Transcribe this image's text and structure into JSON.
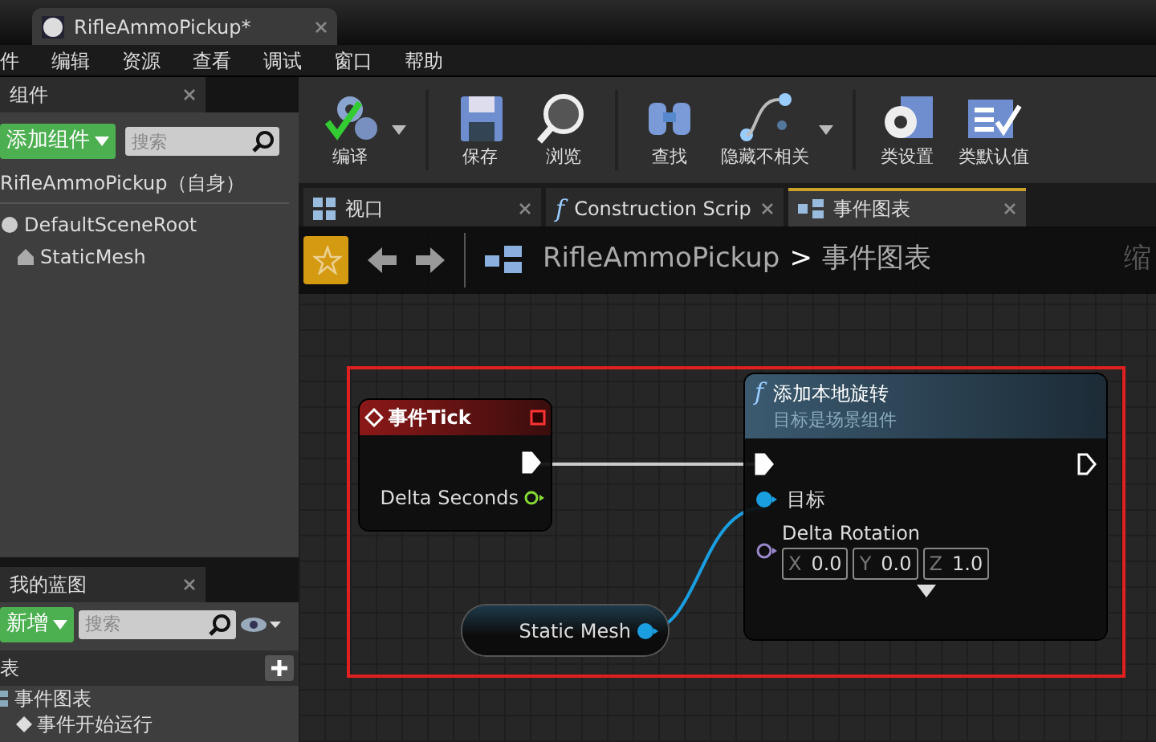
{
  "window": {
    "tab_title": "RifleAmmoPickup*"
  },
  "menu": [
    "件",
    "编辑",
    "资源",
    "查看",
    "调试",
    "窗口",
    "帮助"
  ],
  "components_panel": {
    "tab": "组件",
    "add_button": "添加组件",
    "search": {
      "placeholder": "搜索"
    },
    "self_label": "RifleAmmoPickup（自身）",
    "tree": [
      {
        "label": "DefaultSceneRoot",
        "children": [
          {
            "label": "StaticMesh"
          }
        ]
      }
    ]
  },
  "my_blueprint_panel": {
    "tab": "我的蓝图",
    "new_button": "新增",
    "search": {
      "placeholder": "搜索"
    },
    "section": "表",
    "items": [
      {
        "label": "事件图表",
        "children": [
          {
            "label": "事件开始运行"
          }
        ]
      }
    ]
  },
  "toolbar": [
    {
      "label": "编译",
      "dropdown": true
    },
    {
      "label": "保存",
      "dropdown": false
    },
    {
      "label": "浏览",
      "dropdown": false
    },
    {
      "label": "查找",
      "dropdown": false
    },
    {
      "label": "隐藏不相关",
      "dropdown": true
    },
    {
      "label": "类设置",
      "dropdown": false
    },
    {
      "label": "类默认值",
      "dropdown": false
    }
  ],
  "editor_tabs": [
    {
      "label": "视口",
      "selected": false
    },
    {
      "label": "Construction Scrip",
      "selected": false,
      "glyph": "f"
    },
    {
      "label": "事件图表",
      "selected": true
    }
  ],
  "breadcrumb": {
    "path": [
      "RifleAmmoPickup",
      "事件图表"
    ],
    "separator": ">",
    "zoom_label": "缩"
  },
  "graph": {
    "nodes": [
      {
        "kind": "event",
        "title": "事件Tick",
        "output_label": "Delta Seconds"
      },
      {
        "kind": "function",
        "glyph": "f",
        "title": "添加本地旋转",
        "subtitle": "目标是场景组件",
        "target_label": "目标",
        "input_label": "Delta Rotation",
        "vector": [
          {
            "axis": "X",
            "value": "0.0"
          },
          {
            "axis": "Y",
            "value": "0.0"
          },
          {
            "axis": "Z",
            "value": "1.0"
          }
        ]
      },
      {
        "kind": "variable",
        "label": "Static Mesh"
      }
    ]
  }
}
